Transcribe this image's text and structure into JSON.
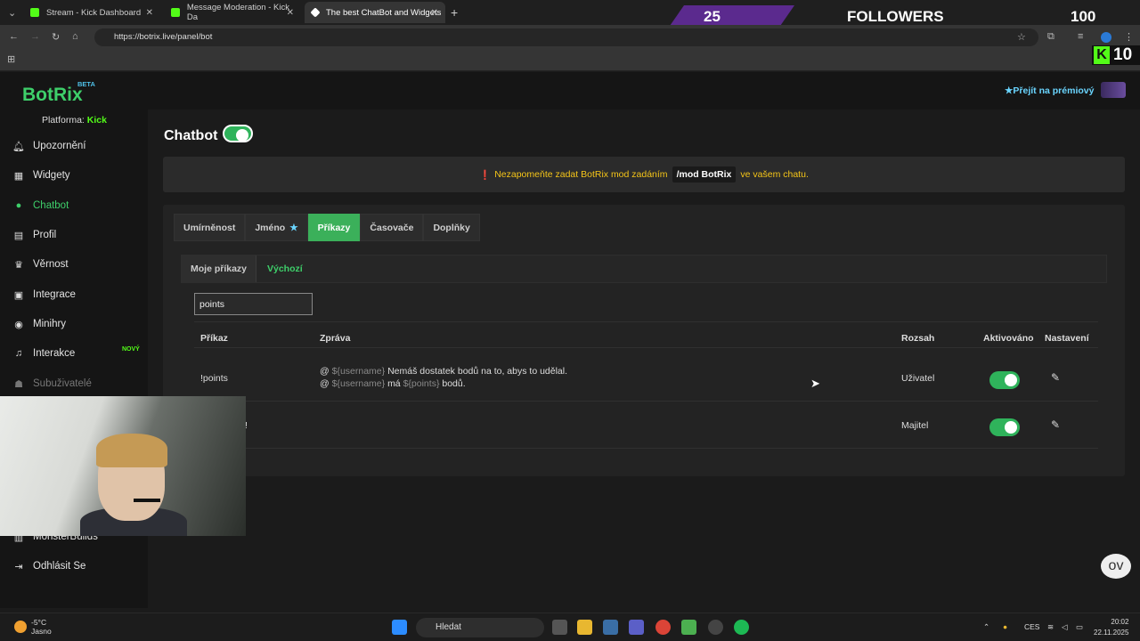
{
  "browser": {
    "tabs": [
      {
        "title": "Stream - Kick Dashboard",
        "fav_color": "#53fc18"
      },
      {
        "title": "Message Moderation - Kick Da",
        "fav_color": "#53fc18"
      },
      {
        "title": "The best ChatBot and Widgets",
        "fav_color": "#ffffff"
      }
    ],
    "url": "https://botrix.live/panel/bot"
  },
  "overlay": {
    "follow_current": "25",
    "follow_label": "FOLLOWERS",
    "follow_goal": "100",
    "kick_count": "10",
    "kick_letter": "K"
  },
  "header": {
    "logo": "BotRix",
    "beta": "BETA",
    "premium": "Přejít na prémiový"
  },
  "sidebar": {
    "platform_label": "Platforma:",
    "platform_value": "Kick",
    "items": [
      {
        "label": "Upozornění",
        "icon": "bell-icon"
      },
      {
        "label": "Widgety",
        "icon": "grid-icon"
      },
      {
        "label": "Chatbot",
        "icon": "robot-icon"
      },
      {
        "label": "Profil",
        "icon": "id-card-icon"
      },
      {
        "label": "Věrnost",
        "icon": "trophy-icon"
      },
      {
        "label": "Integrace",
        "icon": "puzzle-icon"
      },
      {
        "label": "Minihry",
        "icon": "gamepad-icon"
      },
      {
        "label": "Interakce",
        "icon": "music-icon"
      },
      {
        "label": "Subuživatelé",
        "icon": "users-icon"
      },
      {
        "label": "MonsterBuilds",
        "icon": "box-icon"
      },
      {
        "label": "Odhlásit Se",
        "icon": "logout-icon"
      }
    ],
    "new_badge": "NOVÝ"
  },
  "main": {
    "title": "Chatbot",
    "notice_before": "Nezapomeňte zadat BotRix mod zadáním",
    "notice_code": "/mod BotRix",
    "notice_after": "ve vašem chatu.",
    "tabs": [
      "Umírněnost",
      "Jméno",
      "Příkazy",
      "Časovače",
      "Doplňky"
    ],
    "subtabs": [
      "Moje příkazy",
      "Výchozí"
    ],
    "search_value": "points",
    "columns": [
      "Příkaz",
      "Zpráva",
      "Rozsah",
      "Aktivováno",
      "Nastavení"
    ],
    "rows": [
      {
        "command": "!points",
        "line1_prefix": "@",
        "line1_var": "${username}",
        "line1_text": "Nemáš dostatek bodů na to, abys to udělal.",
        "line2_prefix": "@",
        "line2_var": "${username}",
        "line2_mid": "má",
        "line2_var2": "${points}",
        "line2_text": "bodů.",
        "scope": "Uživatel",
        "enabled": true
      },
      {
        "command": "!",
        "scope": "Majitel",
        "enabled": true
      }
    ]
  },
  "taskbar": {
    "temp": "-5°C",
    "weather": "Jasno",
    "search": "Hledat",
    "lang": "CES",
    "time": "20:02",
    "date": "22.11.2025"
  },
  "colors": {
    "accent": "#3ecf6a",
    "kick": "#53fc18",
    "warning": "#f5c518"
  }
}
